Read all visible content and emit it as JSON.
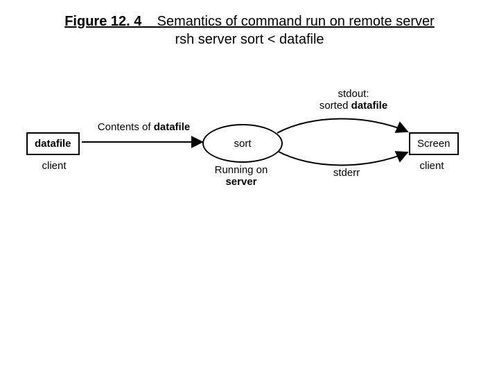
{
  "title": {
    "fig_num": "Figure 12. 4",
    "text1_rest": "Semantics of command run on remote server",
    "line2": "rsh server sort < datafile"
  },
  "nodes": {
    "datafile": {
      "label": "datafile",
      "caption": "client"
    },
    "sort": {
      "label": "sort",
      "caption_pre": "Running on",
      "caption_bold": "server"
    },
    "screen": {
      "label": "Screen",
      "caption": "client"
    }
  },
  "edges": {
    "datafile_to_sort": {
      "pre": "Contents of ",
      "bold": "datafile"
    },
    "sort_to_screen_top": {
      "pre": "stdout:",
      "mid": "sorted ",
      "bold": "datafile"
    },
    "sort_to_screen_bottom": {
      "label": "stderr"
    }
  }
}
